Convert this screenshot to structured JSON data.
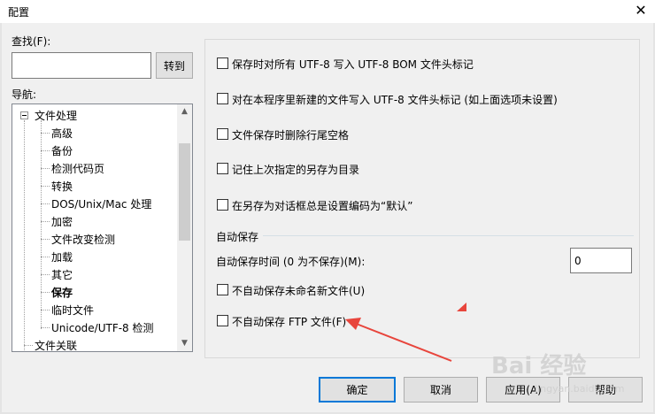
{
  "window": {
    "title": "配置",
    "close_symbol": "✕"
  },
  "search": {
    "label": "查找(F):",
    "value": "",
    "goto_label": "转到"
  },
  "nav": {
    "label": "导航:",
    "tree": [
      {
        "text": "文件处理",
        "level": 0,
        "expanded": true,
        "bold": false
      },
      {
        "text": "高级",
        "level": 1,
        "bold": false
      },
      {
        "text": "备份",
        "level": 1,
        "bold": false
      },
      {
        "text": "检测代码页",
        "level": 1,
        "bold": false
      },
      {
        "text": "转换",
        "level": 1,
        "bold": false
      },
      {
        "text": "DOS/Unix/Mac 处理",
        "level": 1,
        "bold": false
      },
      {
        "text": "加密",
        "level": 1,
        "bold": false
      },
      {
        "text": "文件改变检测",
        "level": 1,
        "bold": false
      },
      {
        "text": "加载",
        "level": 1,
        "bold": false
      },
      {
        "text": "其它",
        "level": 1,
        "bold": false
      },
      {
        "text": "保存",
        "level": 1,
        "bold": true
      },
      {
        "text": "临时文件",
        "level": 1,
        "bold": false
      },
      {
        "text": "Unicode/UTF-8 检测",
        "level": 1,
        "bold": false
      },
      {
        "text": "文件关联",
        "level": 0,
        "bold": false
      }
    ],
    "scroll_up": "▲",
    "scroll_down": "▼"
  },
  "options": [
    {
      "label": "保存时对所有 UTF-8 写入 UTF-8 BOM 文件头标记",
      "checked": false
    },
    {
      "label": "对在本程序里新建的文件写入 UTF-8 文件头标记 (如上面选项未设置)",
      "checked": false
    },
    {
      "label": "文件保存时删除行尾空格",
      "checked": false
    },
    {
      "label": "记住上次指定的另存为目录",
      "checked": false
    },
    {
      "label": "在另存为对话框总是设置编码为“默认”",
      "checked": false
    }
  ],
  "autosave": {
    "group_title": "自动保存",
    "interval_label": "自动保存时间 (0 为不保存)(M):",
    "interval_value": "0",
    "no_autosave_untitled": {
      "label": "不自动保存未命名新文件(U)",
      "checked": false
    },
    "no_autosave_ftp": {
      "label": "不自动保存 FTP 文件(F)",
      "checked": false
    }
  },
  "buttons": {
    "ok": "确定",
    "cancel": "取消",
    "apply": "应用(A)",
    "help": "帮助"
  },
  "watermark": {
    "text": "Bai 经验",
    "sub": "jingyan.baidu.com"
  },
  "annotation_color": "#e8453c"
}
